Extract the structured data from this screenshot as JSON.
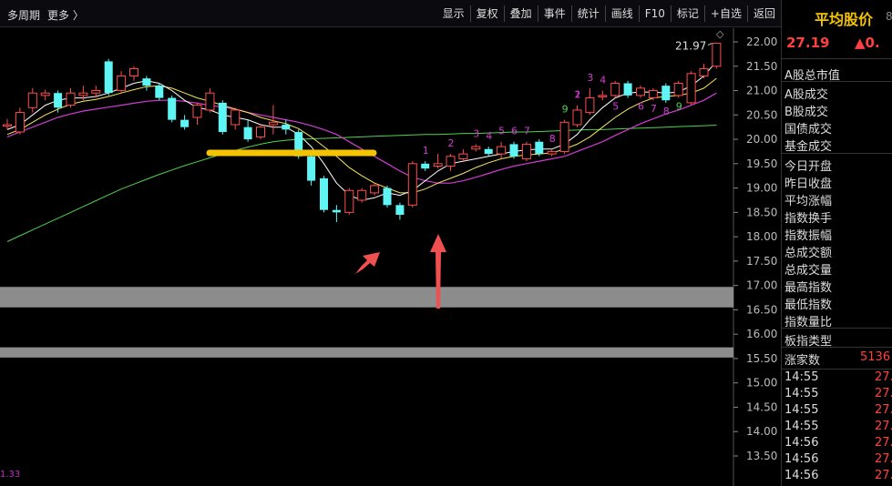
{
  "topbar": {
    "period_label": "多周期",
    "more_label": "更多 〉",
    "buttons": [
      "显示",
      "复权",
      "叠加",
      "事件",
      "统计",
      "画线",
      "F10",
      "标记",
      "+自选",
      "返回"
    ]
  },
  "chart": {
    "y_ticks": [
      "22.00",
      "21.50",
      "21.00",
      "20.50",
      "20.00",
      "19.50",
      "19.00",
      "18.50",
      "18.00",
      "17.50",
      "17.00",
      "16.50",
      "16.00",
      "15.50",
      "15.00",
      "14.50",
      "14.00",
      "13.50"
    ],
    "high_annotation": "21.97",
    "bottom_value": "1.33",
    "down_counts": [
      "1",
      "2",
      "3",
      "4",
      "5",
      "6",
      "7",
      "8",
      "9",
      "1"
    ],
    "up_counts_top": [
      "2",
      "3",
      "4"
    ],
    "up_counts_bottom": [
      "5",
      "6",
      "7",
      "8",
      "9"
    ],
    "colors": {
      "up": "#ff4d4d",
      "down": "#5ff5f5",
      "ma5": "#ffffff",
      "ma10": "#f5e65a",
      "ma20": "#d23cd2",
      "ma60": "#4fd24f",
      "bar": "#f5c400",
      "arrow": "#f05050"
    }
  },
  "chart_data": {
    "type": "candlestick",
    "y_range": [
      13.4,
      22.3
    ],
    "candles": [
      {
        "o": 20.27,
        "c": 20.3,
        "h": 20.42,
        "l": 20.2
      },
      {
        "o": 20.15,
        "c": 20.55,
        "h": 20.65,
        "l": 20.1
      },
      {
        "o": 20.65,
        "c": 20.95,
        "h": 21.05,
        "l": 20.55
      },
      {
        "o": 20.9,
        "c": 20.95,
        "h": 21.02,
        "l": 20.8
      },
      {
        "o": 20.95,
        "c": 20.65,
        "h": 21.0,
        "l": 20.55
      },
      {
        "o": 20.7,
        "c": 20.95,
        "h": 21.05,
        "l": 20.65
      },
      {
        "o": 20.9,
        "c": 20.95,
        "h": 21.1,
        "l": 20.8
      },
      {
        "o": 20.95,
        "c": 21.0,
        "h": 21.1,
        "l": 20.85
      },
      {
        "o": 21.6,
        "c": 20.95,
        "h": 21.65,
        "l": 20.9
      },
      {
        "o": 21.0,
        "c": 21.3,
        "h": 21.4,
        "l": 20.95
      },
      {
        "o": 21.3,
        "c": 21.45,
        "h": 21.5,
        "l": 21.2
      },
      {
        "o": 21.25,
        "c": 21.1,
        "h": 21.3,
        "l": 21.0
      },
      {
        "o": 21.1,
        "c": 20.85,
        "h": 21.15,
        "l": 20.8
      },
      {
        "o": 20.85,
        "c": 20.4,
        "h": 20.9,
        "l": 20.35
      },
      {
        "o": 20.4,
        "c": 20.25,
        "h": 20.5,
        "l": 20.2
      },
      {
        "o": 20.45,
        "c": 20.7,
        "h": 20.75,
        "l": 20.3
      },
      {
        "o": 20.6,
        "c": 20.95,
        "h": 21.05,
        "l": 20.55
      },
      {
        "o": 20.75,
        "c": 20.15,
        "h": 20.8,
        "l": 20.1
      },
      {
        "o": 20.3,
        "c": 20.6,
        "h": 20.65,
        "l": 20.2
      },
      {
        "o": 20.25,
        "c": 20.0,
        "h": 20.4,
        "l": 19.95
      },
      {
        "o": 20.05,
        "c": 20.25,
        "h": 20.3,
        "l": 20.0
      },
      {
        "o": 20.3,
        "c": 20.35,
        "h": 20.7,
        "l": 20.1
      },
      {
        "o": 20.3,
        "c": 20.2,
        "h": 20.4,
        "l": 20.1
      },
      {
        "o": 20.15,
        "c": 19.65,
        "h": 20.2,
        "l": 19.6
      },
      {
        "o": 19.65,
        "c": 19.15,
        "h": 19.7,
        "l": 19.05
      },
      {
        "o": 19.2,
        "c": 18.55,
        "h": 19.25,
        "l": 18.5
      },
      {
        "o": 18.55,
        "c": 18.5,
        "h": 18.65,
        "l": 18.3
      },
      {
        "o": 18.5,
        "c": 18.95,
        "h": 19.0,
        "l": 18.45
      },
      {
        "o": 18.75,
        "c": 18.95,
        "h": 19.0,
        "l": 18.7
      },
      {
        "o": 18.9,
        "c": 19.05,
        "h": 19.1,
        "l": 18.85
      },
      {
        "o": 19.0,
        "c": 18.65,
        "h": 19.05,
        "l": 18.6
      },
      {
        "o": 18.65,
        "c": 18.45,
        "h": 18.7,
        "l": 18.35
      },
      {
        "o": 18.65,
        "c": 19.5,
        "h": 19.55,
        "l": 18.6
      },
      {
        "o": 19.5,
        "c": 19.4,
        "h": 19.55,
        "l": 19.35
      },
      {
        "o": 19.45,
        "c": 19.5,
        "h": 19.7,
        "l": 19.4
      },
      {
        "o": 19.45,
        "c": 19.65,
        "h": 19.7,
        "l": 19.35
      },
      {
        "o": 19.6,
        "c": 19.7,
        "h": 19.8,
        "l": 19.55
      },
      {
        "o": 19.8,
        "c": 19.85,
        "h": 19.9,
        "l": 19.75
      },
      {
        "o": 19.8,
        "c": 19.7,
        "h": 19.85,
        "l": 19.65
      },
      {
        "o": 19.7,
        "c": 19.85,
        "h": 19.95,
        "l": 19.6
      },
      {
        "o": 19.9,
        "c": 19.65,
        "h": 19.95,
        "l": 19.6
      },
      {
        "o": 19.6,
        "c": 19.9,
        "h": 19.95,
        "l": 19.55
      },
      {
        "o": 19.95,
        "c": 19.7,
        "h": 20.0,
        "l": 19.65
      },
      {
        "o": 19.7,
        "c": 19.75,
        "h": 19.8,
        "l": 19.65
      },
      {
        "o": 19.75,
        "c": 20.35,
        "h": 20.4,
        "l": 19.7
      },
      {
        "o": 20.3,
        "c": 20.6,
        "h": 20.7,
        "l": 20.25
      },
      {
        "o": 20.55,
        "c": 20.85,
        "h": 21.05,
        "l": 20.5
      },
      {
        "o": 20.9,
        "c": 20.9,
        "h": 21.0,
        "l": 20.8
      },
      {
        "o": 20.9,
        "c": 21.15,
        "h": 21.2,
        "l": 20.85
      },
      {
        "o": 21.15,
        "c": 20.9,
        "h": 21.2,
        "l": 20.85
      },
      {
        "o": 20.9,
        "c": 21.05,
        "h": 21.1,
        "l": 20.85
      },
      {
        "o": 20.85,
        "c": 21.0,
        "h": 21.05,
        "l": 20.8
      },
      {
        "o": 21.1,
        "c": 20.8,
        "h": 21.15,
        "l": 20.75
      },
      {
        "o": 20.9,
        "c": 21.15,
        "h": 21.2,
        "l": 20.85
      },
      {
        "o": 20.75,
        "c": 21.35,
        "h": 21.4,
        "l": 20.7
      },
      {
        "o": 21.3,
        "c": 21.45,
        "h": 21.55,
        "l": 21.25
      },
      {
        "o": 21.5,
        "c": 21.97,
        "h": 21.97,
        "l": 21.45
      }
    ],
    "ma5": [
      20.2,
      20.3,
      20.5,
      20.7,
      20.8,
      20.85,
      20.85,
      20.88,
      20.95,
      21.05,
      21.15,
      21.2,
      21.15,
      21.0,
      20.8,
      20.65,
      20.6,
      20.5,
      20.45,
      20.4,
      20.3,
      20.25,
      20.25,
      20.1,
      19.85,
      19.5,
      19.1,
      18.85,
      18.75,
      18.8,
      18.9,
      18.85,
      18.95,
      19.15,
      19.35,
      19.5,
      19.55,
      19.6,
      19.65,
      19.7,
      19.75,
      19.78,
      19.8,
      19.8,
      19.9,
      20.1,
      20.4,
      20.65,
      20.85,
      20.95,
      20.97,
      20.97,
      20.95,
      20.97,
      21.1,
      21.3,
      21.6
    ],
    "ma10": [
      20.1,
      20.2,
      20.35,
      20.5,
      20.62,
      20.72,
      20.78,
      20.82,
      20.88,
      20.95,
      21.02,
      21.08,
      21.1,
      21.05,
      20.95,
      20.85,
      20.78,
      20.7,
      20.62,
      20.55,
      20.45,
      20.38,
      20.32,
      20.22,
      20.05,
      19.85,
      19.65,
      19.42,
      19.25,
      19.1,
      19.0,
      18.9,
      18.9,
      18.98,
      19.1,
      19.2,
      19.3,
      19.42,
      19.52,
      19.6,
      19.65,
      19.68,
      19.7,
      19.72,
      19.8,
      19.9,
      20.05,
      20.25,
      20.45,
      20.62,
      20.75,
      20.85,
      20.88,
      20.9,
      20.95,
      21.05,
      21.25
    ],
    "ma20": [
      20.05,
      20.15,
      20.25,
      20.35,
      20.45,
      20.52,
      20.58,
      20.62,
      20.66,
      20.7,
      20.74,
      20.78,
      20.8,
      20.8,
      20.78,
      20.74,
      20.7,
      20.66,
      20.62,
      20.55,
      20.5,
      20.45,
      20.4,
      20.35,
      20.28,
      20.2,
      20.1,
      19.95,
      19.8,
      19.65,
      19.5,
      19.35,
      19.22,
      19.15,
      19.1,
      19.1,
      19.15,
      19.22,
      19.3,
      19.38,
      19.45,
      19.5,
      19.55,
      19.6,
      19.65,
      19.75,
      19.85,
      19.95,
      20.08,
      20.2,
      20.32,
      20.42,
      20.52,
      20.6,
      20.7,
      20.8,
      20.95
    ],
    "ma60": [
      17.9,
      18.02,
      18.14,
      18.26,
      18.38,
      18.5,
      18.62,
      18.74,
      18.86,
      18.98,
      19.08,
      19.18,
      19.28,
      19.37,
      19.46,
      19.54,
      19.62,
      19.7,
      19.77,
      19.84,
      19.9,
      19.95,
      19.98,
      20.0,
      20.01,
      20.02,
      20.03,
      20.04,
      20.05,
      20.06,
      20.07,
      20.08,
      20.09,
      20.1,
      20.1,
      20.11,
      20.12,
      20.12,
      20.13,
      20.14,
      20.15,
      20.15,
      20.16,
      20.17,
      20.18,
      20.19,
      20.2,
      20.2,
      20.21,
      20.22,
      20.23,
      20.24,
      20.25,
      20.26,
      20.27,
      20.28,
      20.29
    ]
  },
  "panel": {
    "title": "平均股价",
    "title_ext": "8",
    "price": "27.19",
    "change": "▲0.",
    "rows1": [
      "A股总市值"
    ],
    "rows2": [
      "A股成交",
      "B股成交",
      "国债成交",
      "基金成交"
    ],
    "rows3": [
      "今日开盘",
      "昨日收盘",
      "平均涨幅",
      "指数换手",
      "指数振幅",
      "总成交额",
      "总成交量",
      "最高指数",
      "最低指数",
      "指数量比"
    ],
    "rows4": [
      "板指类型"
    ],
    "rise_label": "涨家数",
    "rise_value": "5136",
    "ticks": [
      {
        "time": "14:55",
        "price": "27."
      },
      {
        "time": "14:55",
        "price": "27."
      },
      {
        "time": "14:55",
        "price": "27."
      },
      {
        "time": "14:55",
        "price": "27."
      },
      {
        "time": "14:56",
        "price": "27."
      },
      {
        "time": "14:56",
        "price": "27."
      },
      {
        "time": "14:56",
        "price": "27."
      }
    ]
  }
}
